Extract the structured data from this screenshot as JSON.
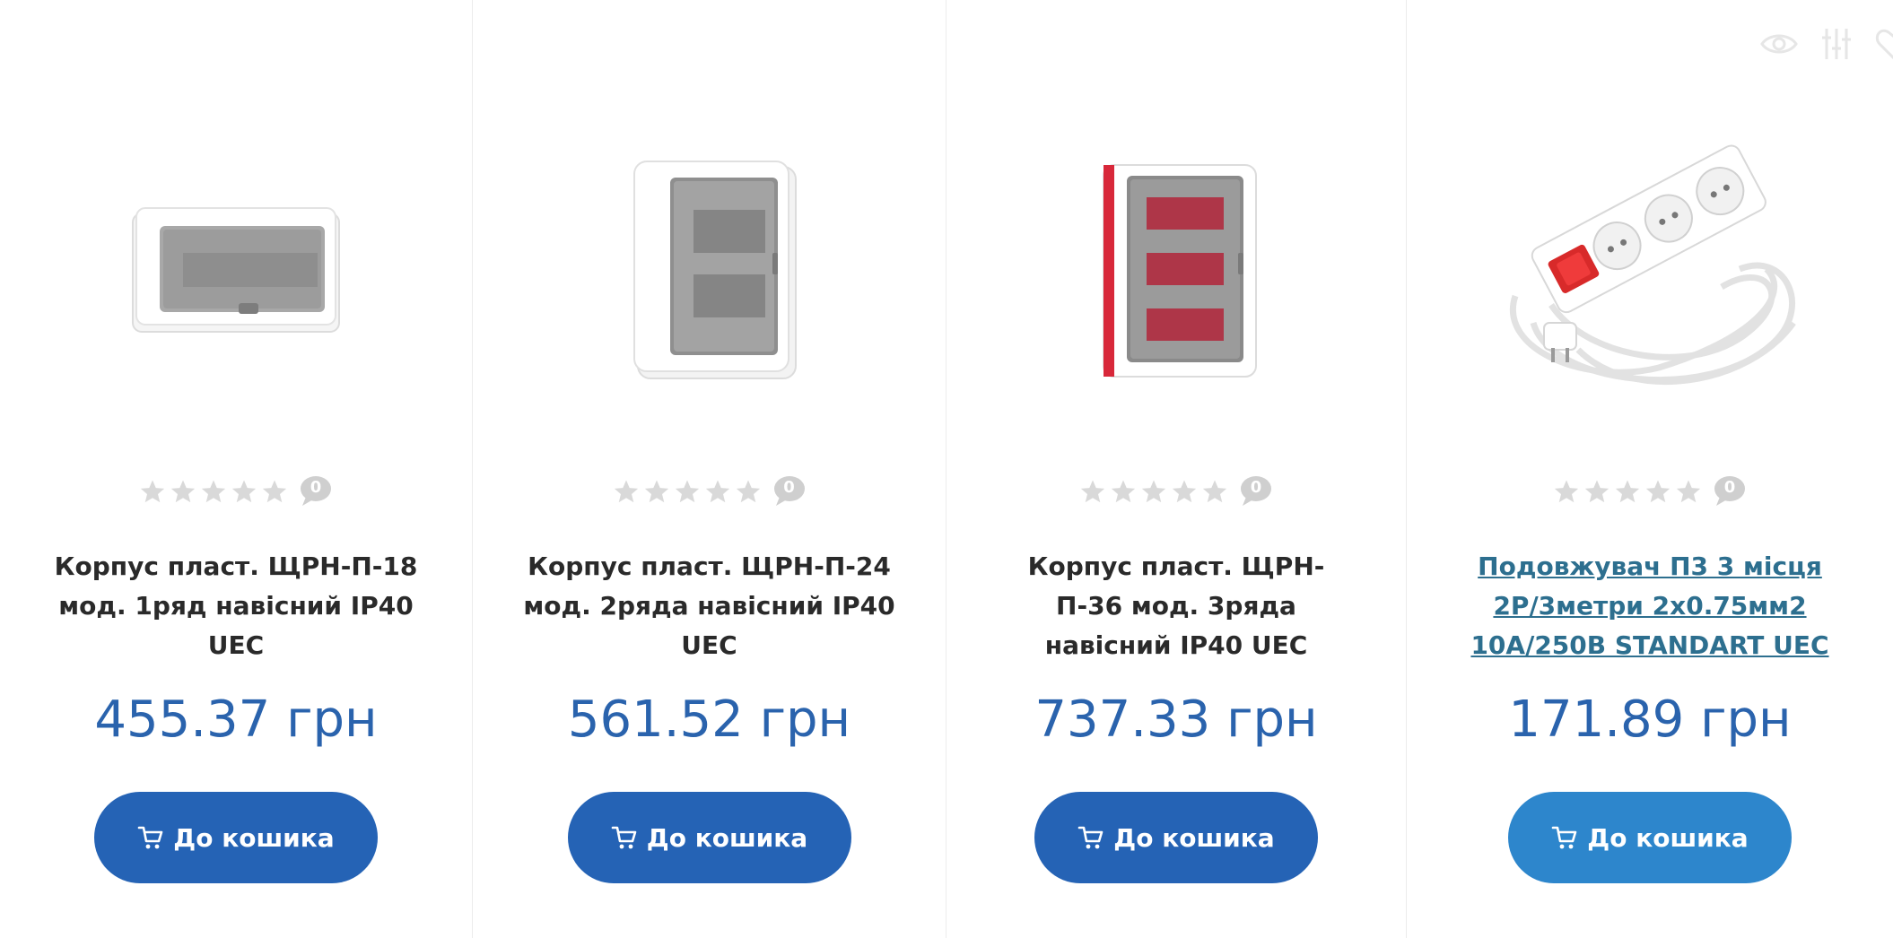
{
  "products": [
    {
      "title": "Корпус пласт. ЩРН-П-18 мод. 1ряд навісний IP40 UEC",
      "rating_count": "0",
      "price": "455.37 грн",
      "cart_label": "До кошика",
      "image_icon": "box-1row-image"
    },
    {
      "title": "Корпус пласт. ЩРН-П-24 мод. 2ряда навісний IP40 UEC",
      "rating_count": "0",
      "price": "561.52 грн",
      "cart_label": "До кошика",
      "image_icon": "box-2row-image"
    },
    {
      "title": "Корпус пласт. ЩРН-П-36 мод. 3ряда навісний IP40 UEC",
      "rating_count": "0",
      "price": "737.33 грн",
      "cart_label": "До кошика",
      "image_icon": "box-3row-image"
    },
    {
      "title": "Подовжувач П3 3 місця 2Р/3метри 2х0.75мм2 10А/250В STANDART UEC",
      "rating_count": "0",
      "price": "171.89 грн",
      "cart_label": "До кошика",
      "image_icon": "extension-cord-image"
    }
  ],
  "colors": {
    "price": "#2a63ad",
    "button": "#2563b5",
    "button_hover": "#2d86cc",
    "link": "#2d6f8f",
    "star": "#d9d9d9"
  },
  "icons": {
    "quick_view": "eye-icon",
    "compare": "compare-icon",
    "wishlist": "heart-icon",
    "cart": "cart-icon",
    "review": "comment-bubble-icon"
  }
}
